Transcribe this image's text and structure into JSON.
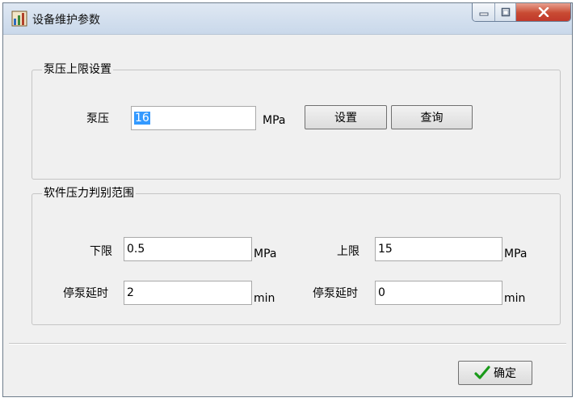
{
  "window": {
    "title": "设备维护参数",
    "icon": "equipment-chart-icon",
    "controls": {
      "minimize": "minimize-icon",
      "maximize": "maximize-icon",
      "close": "close-icon"
    }
  },
  "pump_limit": {
    "group_title": "泵压上限设置",
    "pressure_label": "泵压",
    "pressure_value": "16",
    "pressure_unit": "MPa",
    "set_button": "设置",
    "query_button": "查询"
  },
  "range": {
    "group_title": "软件压力判别范围",
    "lower_label": "下限",
    "lower_value": "0.5",
    "lower_unit": "MPa",
    "upper_label": "上限",
    "upper_value": "15",
    "upper_unit": "MPa",
    "delay1_label": "停泵延时",
    "delay1_value": "2",
    "delay1_unit": "min",
    "delay2_label": "停泵延时",
    "delay2_value": "0",
    "delay2_unit": "min"
  },
  "footer": {
    "ok_button": "确定",
    "ok_icon": "checkmark-icon",
    "ok_icon_color": "#1a9a1a"
  }
}
